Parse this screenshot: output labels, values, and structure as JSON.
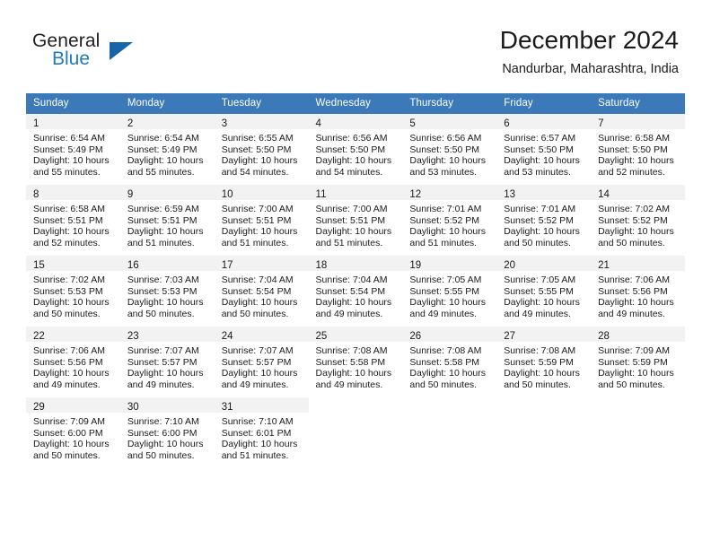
{
  "brand": {
    "name_top": "General",
    "name_bottom": "Blue",
    "triangle_icon": "blue-triangle-icon",
    "color_dark": "#231f20",
    "color_blue": "#1f7ac0"
  },
  "header": {
    "title": "December 2024",
    "subtitle": "Nandurbar, Maharashtra, India"
  },
  "theme": {
    "header_blue": "#3b79b8",
    "daynum_band": "#f2f2f2",
    "text": "#1a1a1a"
  },
  "weekdays": [
    "Sunday",
    "Monday",
    "Tuesday",
    "Wednesday",
    "Thursday",
    "Friday",
    "Saturday"
  ],
  "weeks": [
    [
      {
        "day": "1",
        "sunrise": "Sunrise: 6:54 AM",
        "sunset": "Sunset: 5:49 PM",
        "daylight_line1": "Daylight: 10 hours",
        "daylight_line2": "and 55 minutes."
      },
      {
        "day": "2",
        "sunrise": "Sunrise: 6:54 AM",
        "sunset": "Sunset: 5:49 PM",
        "daylight_line1": "Daylight: 10 hours",
        "daylight_line2": "and 55 minutes."
      },
      {
        "day": "3",
        "sunrise": "Sunrise: 6:55 AM",
        "sunset": "Sunset: 5:50 PM",
        "daylight_line1": "Daylight: 10 hours",
        "daylight_line2": "and 54 minutes."
      },
      {
        "day": "4",
        "sunrise": "Sunrise: 6:56 AM",
        "sunset": "Sunset: 5:50 PM",
        "daylight_line1": "Daylight: 10 hours",
        "daylight_line2": "and 54 minutes."
      },
      {
        "day": "5",
        "sunrise": "Sunrise: 6:56 AM",
        "sunset": "Sunset: 5:50 PM",
        "daylight_line1": "Daylight: 10 hours",
        "daylight_line2": "and 53 minutes."
      },
      {
        "day": "6",
        "sunrise": "Sunrise: 6:57 AM",
        "sunset": "Sunset: 5:50 PM",
        "daylight_line1": "Daylight: 10 hours",
        "daylight_line2": "and 53 minutes."
      },
      {
        "day": "7",
        "sunrise": "Sunrise: 6:58 AM",
        "sunset": "Sunset: 5:50 PM",
        "daylight_line1": "Daylight: 10 hours",
        "daylight_line2": "and 52 minutes."
      }
    ],
    [
      {
        "day": "8",
        "sunrise": "Sunrise: 6:58 AM",
        "sunset": "Sunset: 5:51 PM",
        "daylight_line1": "Daylight: 10 hours",
        "daylight_line2": "and 52 minutes."
      },
      {
        "day": "9",
        "sunrise": "Sunrise: 6:59 AM",
        "sunset": "Sunset: 5:51 PM",
        "daylight_line1": "Daylight: 10 hours",
        "daylight_line2": "and 51 minutes."
      },
      {
        "day": "10",
        "sunrise": "Sunrise: 7:00 AM",
        "sunset": "Sunset: 5:51 PM",
        "daylight_line1": "Daylight: 10 hours",
        "daylight_line2": "and 51 minutes."
      },
      {
        "day": "11",
        "sunrise": "Sunrise: 7:00 AM",
        "sunset": "Sunset: 5:51 PM",
        "daylight_line1": "Daylight: 10 hours",
        "daylight_line2": "and 51 minutes."
      },
      {
        "day": "12",
        "sunrise": "Sunrise: 7:01 AM",
        "sunset": "Sunset: 5:52 PM",
        "daylight_line1": "Daylight: 10 hours",
        "daylight_line2": "and 51 minutes."
      },
      {
        "day": "13",
        "sunrise": "Sunrise: 7:01 AM",
        "sunset": "Sunset: 5:52 PM",
        "daylight_line1": "Daylight: 10 hours",
        "daylight_line2": "and 50 minutes."
      },
      {
        "day": "14",
        "sunrise": "Sunrise: 7:02 AM",
        "sunset": "Sunset: 5:52 PM",
        "daylight_line1": "Daylight: 10 hours",
        "daylight_line2": "and 50 minutes."
      }
    ],
    [
      {
        "day": "15",
        "sunrise": "Sunrise: 7:02 AM",
        "sunset": "Sunset: 5:53 PM",
        "daylight_line1": "Daylight: 10 hours",
        "daylight_line2": "and 50 minutes."
      },
      {
        "day": "16",
        "sunrise": "Sunrise: 7:03 AM",
        "sunset": "Sunset: 5:53 PM",
        "daylight_line1": "Daylight: 10 hours",
        "daylight_line2": "and 50 minutes."
      },
      {
        "day": "17",
        "sunrise": "Sunrise: 7:04 AM",
        "sunset": "Sunset: 5:54 PM",
        "daylight_line1": "Daylight: 10 hours",
        "daylight_line2": "and 50 minutes."
      },
      {
        "day": "18",
        "sunrise": "Sunrise: 7:04 AM",
        "sunset": "Sunset: 5:54 PM",
        "daylight_line1": "Daylight: 10 hours",
        "daylight_line2": "and 49 minutes."
      },
      {
        "day": "19",
        "sunrise": "Sunrise: 7:05 AM",
        "sunset": "Sunset: 5:55 PM",
        "daylight_line1": "Daylight: 10 hours",
        "daylight_line2": "and 49 minutes."
      },
      {
        "day": "20",
        "sunrise": "Sunrise: 7:05 AM",
        "sunset": "Sunset: 5:55 PM",
        "daylight_line1": "Daylight: 10 hours",
        "daylight_line2": "and 49 minutes."
      },
      {
        "day": "21",
        "sunrise": "Sunrise: 7:06 AM",
        "sunset": "Sunset: 5:56 PM",
        "daylight_line1": "Daylight: 10 hours",
        "daylight_line2": "and 49 minutes."
      }
    ],
    [
      {
        "day": "22",
        "sunrise": "Sunrise: 7:06 AM",
        "sunset": "Sunset: 5:56 PM",
        "daylight_line1": "Daylight: 10 hours",
        "daylight_line2": "and 49 minutes."
      },
      {
        "day": "23",
        "sunrise": "Sunrise: 7:07 AM",
        "sunset": "Sunset: 5:57 PM",
        "daylight_line1": "Daylight: 10 hours",
        "daylight_line2": "and 49 minutes."
      },
      {
        "day": "24",
        "sunrise": "Sunrise: 7:07 AM",
        "sunset": "Sunset: 5:57 PM",
        "daylight_line1": "Daylight: 10 hours",
        "daylight_line2": "and 49 minutes."
      },
      {
        "day": "25",
        "sunrise": "Sunrise: 7:08 AM",
        "sunset": "Sunset: 5:58 PM",
        "daylight_line1": "Daylight: 10 hours",
        "daylight_line2": "and 49 minutes."
      },
      {
        "day": "26",
        "sunrise": "Sunrise: 7:08 AM",
        "sunset": "Sunset: 5:58 PM",
        "daylight_line1": "Daylight: 10 hours",
        "daylight_line2": "and 50 minutes."
      },
      {
        "day": "27",
        "sunrise": "Sunrise: 7:08 AM",
        "sunset": "Sunset: 5:59 PM",
        "daylight_line1": "Daylight: 10 hours",
        "daylight_line2": "and 50 minutes."
      },
      {
        "day": "28",
        "sunrise": "Sunrise: 7:09 AM",
        "sunset": "Sunset: 5:59 PM",
        "daylight_line1": "Daylight: 10 hours",
        "daylight_line2": "and 50 minutes."
      }
    ],
    [
      {
        "day": "29",
        "sunrise": "Sunrise: 7:09 AM",
        "sunset": "Sunset: 6:00 PM",
        "daylight_line1": "Daylight: 10 hours",
        "daylight_line2": "and 50 minutes."
      },
      {
        "day": "30",
        "sunrise": "Sunrise: 7:10 AM",
        "sunset": "Sunset: 6:00 PM",
        "daylight_line1": "Daylight: 10 hours",
        "daylight_line2": "and 50 minutes."
      },
      {
        "day": "31",
        "sunrise": "Sunrise: 7:10 AM",
        "sunset": "Sunset: 6:01 PM",
        "daylight_line1": "Daylight: 10 hours",
        "daylight_line2": "and 51 minutes."
      },
      {
        "day": "",
        "sunrise": "",
        "sunset": "",
        "daylight_line1": "",
        "daylight_line2": ""
      },
      {
        "day": "",
        "sunrise": "",
        "sunset": "",
        "daylight_line1": "",
        "daylight_line2": ""
      },
      {
        "day": "",
        "sunrise": "",
        "sunset": "",
        "daylight_line1": "",
        "daylight_line2": ""
      },
      {
        "day": "",
        "sunrise": "",
        "sunset": "",
        "daylight_line1": "",
        "daylight_line2": ""
      }
    ]
  ]
}
